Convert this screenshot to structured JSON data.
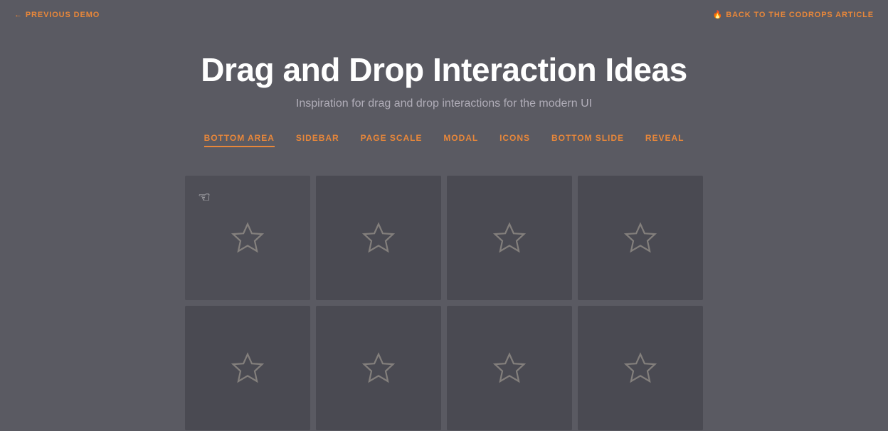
{
  "nav": {
    "previous_demo": "PREVIOUS DEMO",
    "back_to_article": "BACK TO THE CODROPS ARTICLE"
  },
  "header": {
    "title": "Drag and Drop Interaction Ideas",
    "subtitle": "Inspiration for drag and drop interactions for the modern UI"
  },
  "tabs": [
    {
      "id": "bottom-area",
      "label": "BOTTOM AREA",
      "active": true
    },
    {
      "id": "sidebar",
      "label": "SIDEBAR",
      "active": false
    },
    {
      "id": "page-scale",
      "label": "PAGE SCALE",
      "active": false
    },
    {
      "id": "modal",
      "label": "MODAL",
      "active": false
    },
    {
      "id": "icons",
      "label": "ICONS",
      "active": false
    },
    {
      "id": "bottom-slide",
      "label": "BOTTOM SLIDE",
      "active": false
    },
    {
      "id": "reveal",
      "label": "REVEAL",
      "active": false
    }
  ],
  "grid": {
    "rows": 2,
    "cols": 4,
    "total_cards": 8
  },
  "colors": {
    "background": "#5a5a62",
    "card_bg": "#4a4a52",
    "accent": "#e8873a",
    "text_primary": "#ffffff",
    "text_secondary": "#b0adb8"
  }
}
